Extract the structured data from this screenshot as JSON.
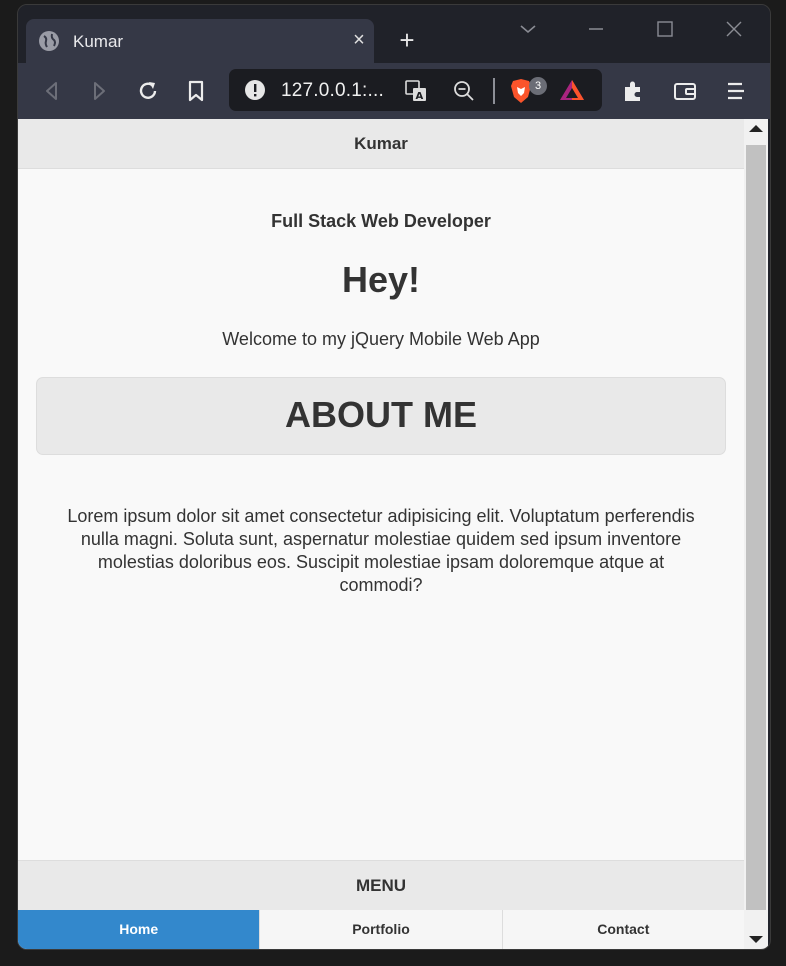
{
  "browser": {
    "tab_title": "Kumar",
    "tab_close": "×",
    "new_tab": "+",
    "url": "127.0.0.1:...",
    "shields_count": "3"
  },
  "page": {
    "header_title": "Kumar",
    "subtitle": "Full Stack Web Developer",
    "greeting": "Hey!",
    "welcome": "Welcome to my jQuery Mobile Web App",
    "about_button": "ABOUT ME",
    "paragraph": "Lorem ipsum dolor sit amet consectetur adipisicing elit. Voluptatum perferendis nulla magni. Soluta sunt, aspernatur molestiae quidem sed ipsum inventore molestias doloribus eos. Suscipit molestiae ipsam doloremque atque at commodi?",
    "menu_title": "MENU",
    "nav": [
      {
        "label": "Home"
      },
      {
        "label": "Portfolio"
      },
      {
        "label": "Contact"
      }
    ]
  },
  "colors": {
    "accent": "#3388cc",
    "brave_orange": "#fb542b"
  }
}
